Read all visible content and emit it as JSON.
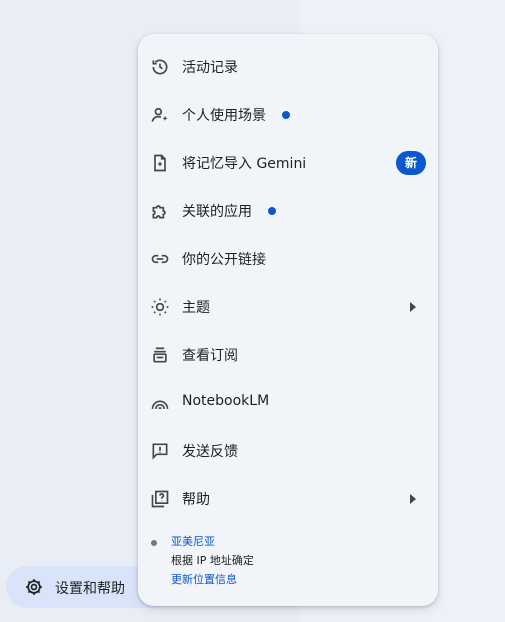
{
  "menu": {
    "items": [
      {
        "label": "活动记录",
        "icon": "history-icon"
      },
      {
        "label": "个人使用场景",
        "icon": "personal-context-icon",
        "dot": true
      },
      {
        "label": "将记忆导入 Gemini",
        "icon": "import-memory-icon",
        "badge": "新"
      },
      {
        "label": "关联的应用",
        "icon": "puzzle-icon",
        "dot": true
      },
      {
        "label": "你的公开链接",
        "icon": "link-icon"
      },
      {
        "label": "主题",
        "icon": "theme-icon",
        "submenu": true
      },
      {
        "label": "查看订阅",
        "icon": "subscription-icon"
      },
      {
        "label": "NotebookLM",
        "icon": "notebooklm-icon"
      },
      {
        "label": "发送反馈",
        "icon": "feedback-icon"
      },
      {
        "label": "帮助",
        "icon": "help-icon",
        "submenu": true
      }
    ],
    "location": {
      "place": "亚美尼亚",
      "determined_by": "根据 IP 地址确定",
      "update_link": "更新位置信息"
    }
  },
  "sidebar": {
    "settings_label": "设置和帮助"
  },
  "colors": {
    "accent": "#0b57d0",
    "menu_bg": "#f1f4f9",
    "selected_bg": "#d9e4fb"
  }
}
